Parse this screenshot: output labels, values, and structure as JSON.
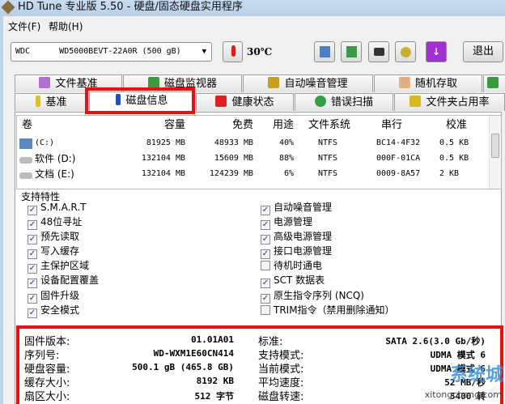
{
  "window": {
    "title": "HD Tune 专业版 5.50 - 硬盘/固态硬盘实用程序"
  },
  "menu": [
    "文件(F)",
    "帮助(H)"
  ],
  "toolbar": {
    "drive": "WDC      WD5000BEVT-22A0R (500 gB)",
    "temperature": "30℃",
    "exit": "退出"
  },
  "tabs_row1": [
    "文件基准",
    "磁盘监视器",
    "自动噪音管理",
    "随机存取"
  ],
  "tabs_row2": [
    "基准",
    "磁盘信息",
    "健康状态",
    "错误扫描",
    "文件夹占用率"
  ],
  "volumes": {
    "headers": [
      "卷",
      "容量",
      "免费",
      "用途",
      "文件系统",
      "串行",
      "校准"
    ],
    "rows": [
      [
        "(C:)",
        "81925 MB",
        "48933 MB",
        "40%",
        "NTFS",
        "BC14-4F32",
        "0.5 KB"
      ],
      [
        "软件 (D:)",
        "132104 MB",
        "15609 MB",
        "88%",
        "NTFS",
        "000F-01CA",
        "0.5 KB"
      ],
      [
        "文档 (E:)",
        "132104 MB",
        "124239 MB",
        "6%",
        "NTFS",
        "0009-8A57",
        "2 KB"
      ]
    ]
  },
  "features": {
    "title": "支持特性",
    "left": [
      {
        "label": "S.M.A.R.T",
        "checked": true
      },
      {
        "label": "48位寻址",
        "checked": true
      },
      {
        "label": "预先读取",
        "checked": true
      },
      {
        "label": "写入缓存",
        "checked": true
      },
      {
        "label": "主保护区域",
        "checked": true
      },
      {
        "label": "设备配置覆盖",
        "checked": true
      },
      {
        "label": "固件升级",
        "checked": true
      },
      {
        "label": "安全模式",
        "checked": true
      }
    ],
    "right": [
      {
        "label": "自动噪音管理",
        "checked": true
      },
      {
        "label": "电源管理",
        "checked": true
      },
      {
        "label": "高级电源管理",
        "checked": true
      },
      {
        "label": "接口电源管理",
        "checked": true
      },
      {
        "label": "待机时通电",
        "checked": false
      },
      {
        "label": "SCT 数据表",
        "checked": true
      },
      {
        "label": "原生指令序列 (NCQ)",
        "checked": true
      },
      {
        "label": "TRIM指令（禁用删除通知）",
        "checked": false
      }
    ]
  },
  "info": {
    "left": [
      [
        "固件版本:",
        "01.01A01"
      ],
      [
        "序列号:",
        "WD-WXM1E60CN414"
      ],
      [
        "硬盘容量:",
        "500.1 gB (465.8 GB)"
      ],
      [
        "缓存大小:",
        "8192 KB"
      ],
      [
        "扇区大小:",
        "512 字节"
      ]
    ],
    "right": [
      [
        "标准:",
        "SATA 2.6(3.0 Gb/秒)"
      ],
      [
        "支持模式:",
        "UDMA 模式 6"
      ],
      [
        "当前模式:",
        "UDMA 模式 6"
      ],
      [
        "平均速度:",
        "52 MB/秒"
      ],
      [
        "磁盘转速:",
        "5400 转"
      ]
    ]
  },
  "watermark": {
    "brand": "系统城",
    "url": "xitongcheng.com"
  }
}
